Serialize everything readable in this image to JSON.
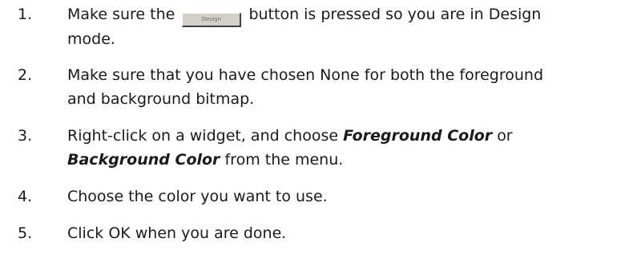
{
  "steps": [
    {
      "number": "1.",
      "text_before": "Make sure the",
      "button_label": "Design",
      "text_after": "button is pressed so you are in Design",
      "text_line2": "mode."
    },
    {
      "number": "2.",
      "line1": "Make sure that you have chosen None for both the foreground",
      "line2": "and background bitmap."
    },
    {
      "number": "3.",
      "text_before": "Right-click on a widget, and choose",
      "emphasis1": "Foreground Color",
      "text_middle": "or",
      "emphasis2": "Background Color",
      "text_after": "from the menu."
    },
    {
      "number": "4.",
      "text": "Choose the color you want to use."
    },
    {
      "number": "5.",
      "text": "Click OK when you are done."
    }
  ]
}
